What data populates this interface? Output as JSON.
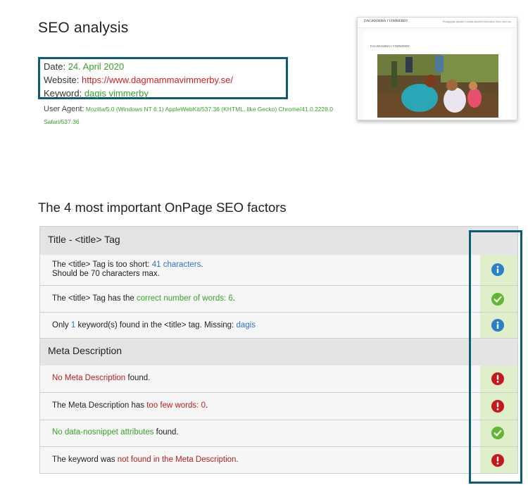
{
  "title": "SEO analysis",
  "meta": {
    "date_label": "Date:",
    "date_value": "24. April 2020",
    "website_label": "Website:",
    "website_value": "https://www.dagmammavimmerby.se/",
    "keyword_label": "Keyword:",
    "keyword_value": "dagis vimmerby",
    "user_agent_label": "User Agent:",
    "user_agent_value": "Mozilla/5.0 (Windows NT 6.1) AppleWebKit/537.36 (KHTML, like Gecko) Chrome/41.0.2228.0 Safari/537.36"
  },
  "thumbnail": {
    "brand": "DAGMAMMA I VIMMERBY",
    "nav": "Pedagogisk tjänster   Kontakt   Aktuellt   Information   Skriv med oss",
    "page_title": "DAGMAMMA I VIMMERBY"
  },
  "factors_heading": "The 4 most important OnPage SEO factors",
  "sections": [
    {
      "title": "Title - <title> Tag",
      "rows": [
        {
          "parts": [
            {
              "text": "The <title> Tag is too short: ",
              "color": "normal"
            },
            {
              "text": "41 characters",
              "color": "blue"
            },
            {
              "text": ".",
              "color": "normal"
            }
          ],
          "line2": "Should be 70 characters max.",
          "status": "info"
        },
        {
          "parts": [
            {
              "text": "The <title> Tag has the ",
              "color": "normal"
            },
            {
              "text": "correct number of words: 6",
              "color": "green"
            },
            {
              "text": ".",
              "color": "normal"
            }
          ],
          "status": "ok"
        },
        {
          "parts": [
            {
              "text": "Only ",
              "color": "normal"
            },
            {
              "text": "1",
              "color": "blue"
            },
            {
              "text": " keyword(s) found in the <title> tag. Missing: ",
              "color": "normal"
            },
            {
              "text": "dagis",
              "color": "blue"
            }
          ],
          "status": "info"
        }
      ]
    },
    {
      "title": "Meta Description",
      "rows": [
        {
          "parts": [
            {
              "text": "No Meta Description",
              "color": "red"
            },
            {
              "text": " found.",
              "color": "normal"
            }
          ],
          "status": "error"
        },
        {
          "parts": [
            {
              "text": "The Meta Description has ",
              "color": "normal"
            },
            {
              "text": "too few words: 0",
              "color": "red"
            },
            {
              "text": ".",
              "color": "normal"
            }
          ],
          "status": "error"
        },
        {
          "parts": [
            {
              "text": "No data-nosnippet attributes",
              "color": "green"
            },
            {
              "text": " found.",
              "color": "normal"
            }
          ],
          "status": "ok"
        },
        {
          "parts": [
            {
              "text": "The keyword was ",
              "color": "normal"
            },
            {
              "text": "not found in the Meta Description",
              "color": "red"
            },
            {
              "text": ".",
              "color": "normal"
            }
          ],
          "status": "error"
        }
      ]
    }
  ],
  "colors": {
    "accent_frame": "#0f5a78",
    "green": "#3aa12a",
    "red": "#d21f1f",
    "blue": "#2f73c4",
    "status_bg": "#dfeecb",
    "info_icon": "#2a7fc9",
    "ok_icon": "#5fb82f",
    "error_icon": "#c9171d"
  }
}
